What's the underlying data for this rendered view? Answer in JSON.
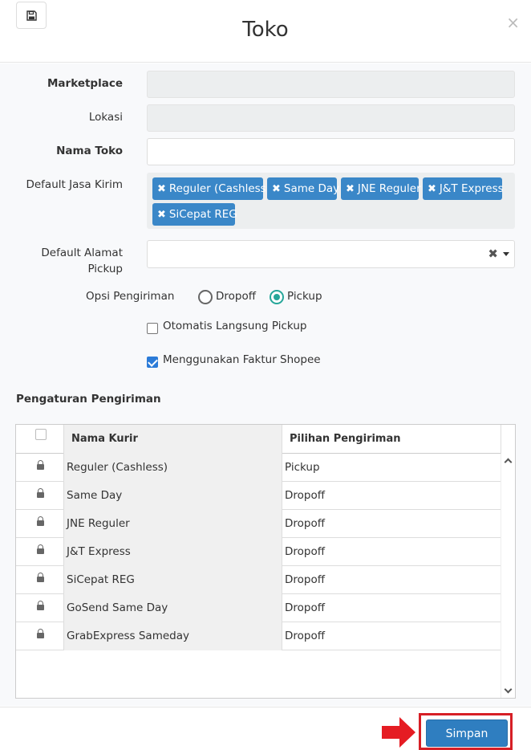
{
  "header": {
    "title": "Toko",
    "save_icon": "floppy-disk-icon",
    "close_label": "×"
  },
  "form": {
    "marketplace_label": "Marketplace",
    "lokasi_label": "Lokasi",
    "nama_toko_label": "Nama Toko",
    "jasa_kirim_label": "Default Jasa Kirim",
    "jasa_kirim_tags": [
      "Reguler (Cashless)",
      "Same Day",
      "JNE Reguler",
      "J&T Express",
      "SiCepat REG"
    ],
    "alamat_label_1": "Default Alamat",
    "alamat_label_2": "Pickup",
    "opsi_label": "Opsi Pengiriman",
    "opsi_dropoff": "Dropoff",
    "opsi_pickup": "Pickup",
    "opsi_selected": "Pickup",
    "auto_pickup_label": "Otomatis Langsung Pickup",
    "auto_pickup_checked": false,
    "faktur_label": "Menggunakan Faktur Shopee",
    "faktur_checked": true
  },
  "section": {
    "title": "Pengaturan Pengiriman"
  },
  "grid": {
    "col_kurir": "Nama Kurir",
    "col_pilihan": "Pilihan Pengiriman",
    "rows": [
      {
        "kurir": "Reguler (Cashless)",
        "pilihan": "Pickup"
      },
      {
        "kurir": "Same Day",
        "pilihan": "Dropoff"
      },
      {
        "kurir": "JNE Reguler",
        "pilihan": "Dropoff"
      },
      {
        "kurir": "J&T Express",
        "pilihan": "Dropoff"
      },
      {
        "kurir": "SiCepat REG",
        "pilihan": "Dropoff"
      },
      {
        "kurir": "GoSend Same Day",
        "pilihan": "Dropoff"
      },
      {
        "kurir": "GrabExpress Sameday",
        "pilihan": "Dropoff"
      }
    ]
  },
  "footer": {
    "save_label": "Simpan"
  },
  "colors": {
    "primary": "#2f7ec0",
    "tag": "#3a87c8",
    "radio": "#26a69a",
    "highlight": "#d61f26"
  }
}
